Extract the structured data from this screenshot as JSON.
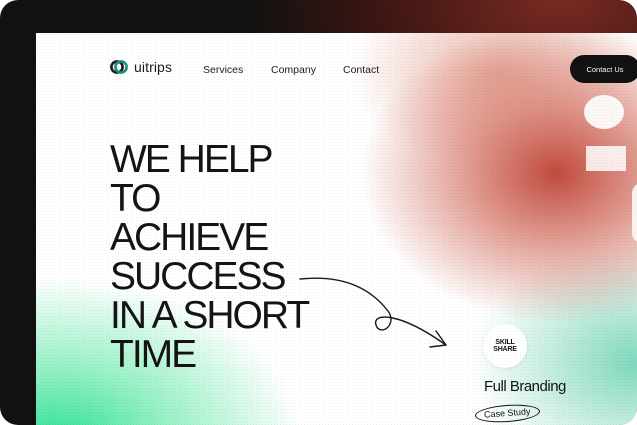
{
  "header": {
    "logo_text": "uitrips",
    "nav": [
      "Services",
      "Company",
      "Contact"
    ],
    "contact_button": "Contact Us"
  },
  "hero": {
    "lines": [
      "WE HELP",
      "TO",
      "ACHIEVE",
      "SUCCESS",
      "IN A SHORT",
      "TIME"
    ]
  },
  "card": {
    "badge_line1": "SKILL",
    "badge_line2": "SHARE",
    "title": "Full Branding",
    "link": "Case Study"
  },
  "colors": {
    "dark": "#111111",
    "accent_red": "#c24a3e",
    "accent_green": "#2fe098",
    "logo_teal": "#1c8f85"
  },
  "icons": {
    "logo": "link-rings-icon",
    "arrow": "curved-arrow-icon"
  }
}
